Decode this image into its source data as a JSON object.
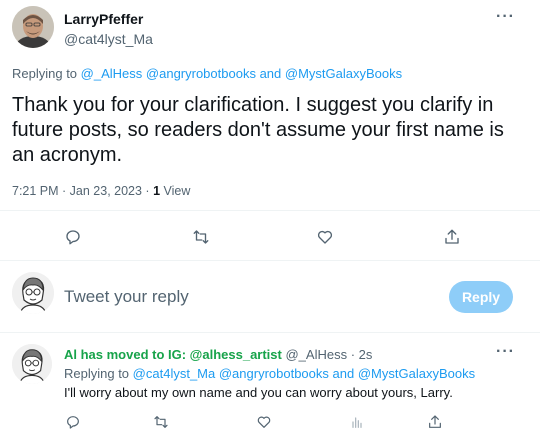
{
  "tweet": {
    "author_name": "LarryPfeffer",
    "author_handle": "@cat4lyst_Ma",
    "more_label": "···",
    "replying_prefix": "Replying to",
    "replying_mention_1": "@_AlHess",
    "replying_mention_2": "@angryrobotbooks",
    "replying_and": "and",
    "replying_mention_3": "@MystGalaxyBooks",
    "text": "Thank you for your clarification. I suggest you clarify in future posts, so readers don't assume your first name is an acronym.",
    "time": "7:21 PM · Jan 23, 2023 · ",
    "view_count": "1",
    "view_label": " View",
    "actions": [
      "reply-icon",
      "retweet-icon",
      "like-icon",
      "share-icon"
    ]
  },
  "composer": {
    "placeholder": "Tweet your reply",
    "button_label": "Reply"
  },
  "reply": {
    "author_name": "Al has moved to IG: @alhess_artist",
    "author_handle": "@_AlHess · 2s",
    "more_label": "···",
    "replying_prefix": "Replying to",
    "replying_mention_1": "@cat4lyst_Ma",
    "replying_mention_2": "@angryrobotbooks",
    "replying_and": "and",
    "replying_mention_3": "@MystGalaxyBooks",
    "text": "I'll worry about my own name and you can worry about yours, Larry.",
    "actions": [
      "reply-icon",
      "retweet-icon",
      "like-icon",
      "analytics-icon",
      "share-icon"
    ]
  },
  "colors": {
    "link": "#1d9bf0",
    "reply_name": "#17a34a",
    "reply_button": "#8ecdf8",
    "secondary_text": "#536471"
  }
}
